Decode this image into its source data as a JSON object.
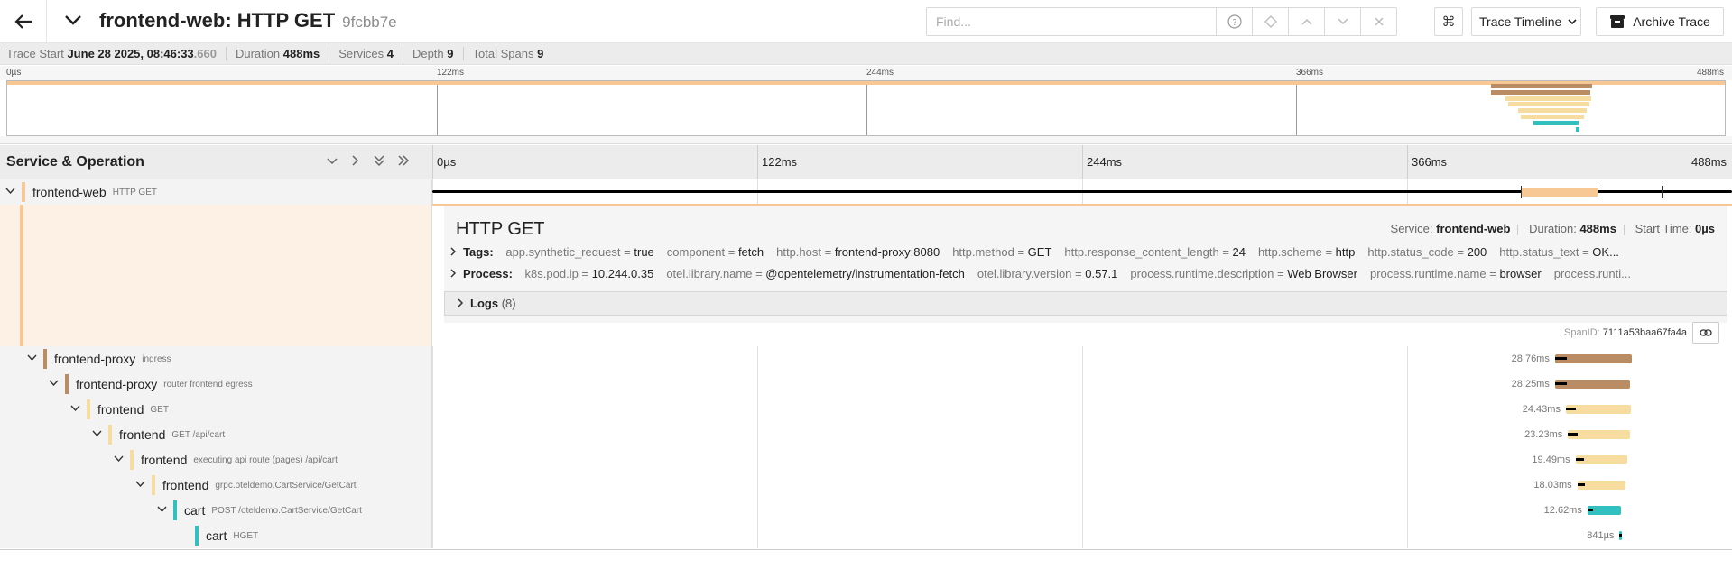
{
  "header": {
    "title": "frontend-web: HTTP GET",
    "trace_id_short": "9fcbb7e",
    "find_placeholder": "Find...",
    "view_select_label": "Trace Timeline",
    "archive_label": "Archive Trace",
    "cmd_symbol": "⌘",
    "back_icon": "arrow-left-icon"
  },
  "summary": {
    "trace_start_label": "Trace Start",
    "trace_start_value": "June 28 2025, 08:46:33",
    "trace_start_ms": ".660",
    "duration_label": "Duration",
    "duration_value": "488ms",
    "services_label": "Services",
    "services_value": "4",
    "depth_label": "Depth",
    "depth_value": "9",
    "total_spans_label": "Total Spans",
    "total_spans_value": "9"
  },
  "minimap": {
    "ticks": [
      "0µs",
      "122ms",
      "244ms",
      "366ms",
      "488ms"
    ]
  },
  "timeline": {
    "column_title": "Service & Operation",
    "ticks": [
      "0µs",
      "122ms",
      "244ms",
      "366ms",
      "488ms"
    ]
  },
  "colors": {
    "frontend_web": "#f8c894",
    "frontend_proxy": "#b98c63",
    "frontend": "#f7dca0",
    "cart": "#32bfbf"
  },
  "spans": [
    {
      "service": "frontend-web",
      "operation": "HTTP GET",
      "depth": 0,
      "duration": "",
      "color": "#f8c894",
      "start": 0.0,
      "end": 1.0
    },
    {
      "service": "frontend-proxy",
      "operation": "ingress",
      "depth": 1,
      "duration": "28.76ms",
      "color": "#b98c63",
      "start": 0.8638,
      "end": 0.9228
    },
    {
      "service": "frontend-proxy",
      "operation": "router frontend egress",
      "depth": 2,
      "duration": "28.25ms",
      "color": "#b98c63",
      "start": 0.8638,
      "end": 0.9217
    },
    {
      "service": "frontend",
      "operation": "GET",
      "depth": 3,
      "duration": "24.43ms",
      "color": "#f7dca0",
      "start": 0.8722,
      "end": 0.9223
    },
    {
      "service": "frontend",
      "operation": "GET /api/cart",
      "depth": 4,
      "duration": "23.23ms",
      "color": "#f7dca0",
      "start": 0.8738,
      "end": 0.9214
    },
    {
      "service": "frontend",
      "operation": "executing api route (pages) /api/cart",
      "depth": 5,
      "duration": "19.49ms",
      "color": "#f7dca0",
      "start": 0.8796,
      "end": 0.9196
    },
    {
      "service": "frontend",
      "operation": "grpc.oteldemo.CartService/GetCart",
      "depth": 6,
      "duration": "18.03ms",
      "color": "#f7dca0",
      "start": 0.881,
      "end": 0.918
    },
    {
      "service": "cart",
      "operation": "POST /oteldemo.CartService/GetCart",
      "depth": 7,
      "duration": "12.62ms",
      "color": "#32bfbf",
      "start": 0.8888,
      "end": 0.9147
    },
    {
      "service": "cart",
      "operation": "HGET",
      "depth": 8,
      "duration": "841µs",
      "color": "#32bfbf",
      "start": 0.9135,
      "end": 0.9152
    }
  ],
  "detail": {
    "title": "HTTP GET",
    "service_label": "Service:",
    "service_value": "frontend-web",
    "duration_label": "Duration:",
    "duration_value": "488ms",
    "start_label": "Start Time:",
    "start_value": "0µs",
    "tags_label": "Tags:",
    "tags": [
      {
        "k": "app.synthetic_request",
        "v": "true"
      },
      {
        "k": "component",
        "v": "fetch"
      },
      {
        "k": "http.host",
        "v": "frontend-proxy:8080"
      },
      {
        "k": "http.method",
        "v": "GET"
      },
      {
        "k": "http.response_content_length",
        "v": "24"
      },
      {
        "k": "http.scheme",
        "v": "http"
      },
      {
        "k": "http.status_code",
        "v": "200"
      },
      {
        "k": "http.status_text",
        "v": "OK..."
      }
    ],
    "process_label": "Process:",
    "process": [
      {
        "k": "k8s.pod.ip",
        "v": "10.244.0.35"
      },
      {
        "k": "otel.library.name",
        "v": "@opentelemetry/instrumentation-fetch"
      },
      {
        "k": "otel.library.version",
        "v": "0.57.1"
      },
      {
        "k": "process.runtime.description",
        "v": "Web Browser"
      },
      {
        "k": "process.runtime.name",
        "v": "browser"
      },
      {
        "k": "process.runti...",
        "v": ""
      }
    ],
    "logs_label": "Logs",
    "logs_count": "(8)",
    "span_id_label": "SpanID:",
    "span_id_value": "7111a53baa67fa4a"
  }
}
